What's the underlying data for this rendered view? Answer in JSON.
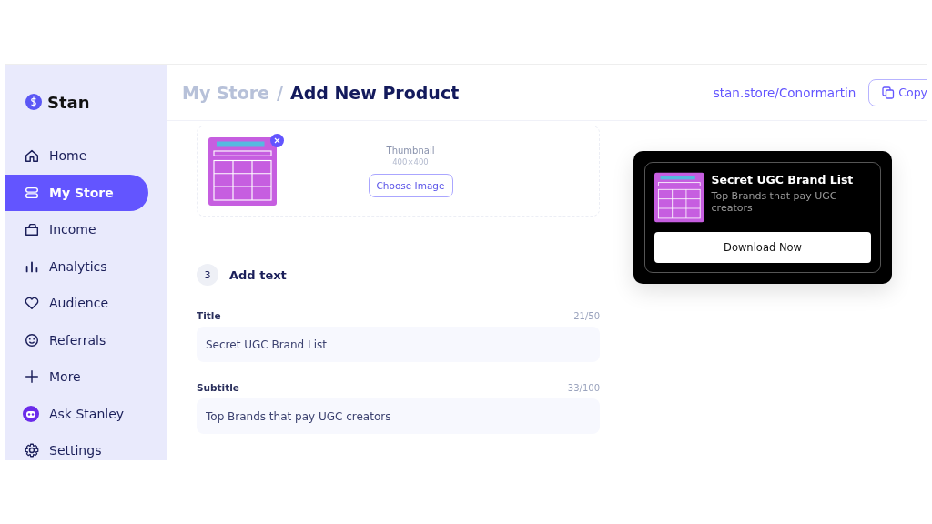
{
  "sidebar": {
    "brand": "Stan",
    "items": [
      {
        "label": "Home",
        "selected": false
      },
      {
        "label": "My Store",
        "selected": true
      },
      {
        "label": "Income",
        "selected": false
      },
      {
        "label": "Analytics",
        "selected": false
      },
      {
        "label": "Audience",
        "selected": false
      },
      {
        "label": "Referrals",
        "selected": false
      },
      {
        "label": "More",
        "selected": false
      },
      {
        "label": "Ask Stanley",
        "selected": false
      },
      {
        "label": "Settings",
        "selected": false
      }
    ]
  },
  "header": {
    "breadcrumb": [
      "My Store",
      "/",
      "Add New Product"
    ],
    "store_link": "stan.store/Conormartin",
    "copy_button": "Copy"
  },
  "thumbnail": {
    "label": "Thumbnail",
    "size": "400×400",
    "button": "Choose Image"
  },
  "section": {
    "number": "3",
    "title": "Add text"
  },
  "fields": [
    {
      "label": "Title",
      "count": "21/50",
      "value": "Secret UGC Brand List"
    },
    {
      "label": "Subtitle",
      "count": "33/100",
      "value": "Top Brands that pay UGC creators"
    }
  ],
  "preview": {
    "title": "Secret UGC Brand List",
    "subtitle": "Top Brands that pay UGC creators",
    "button": "Download Now"
  }
}
